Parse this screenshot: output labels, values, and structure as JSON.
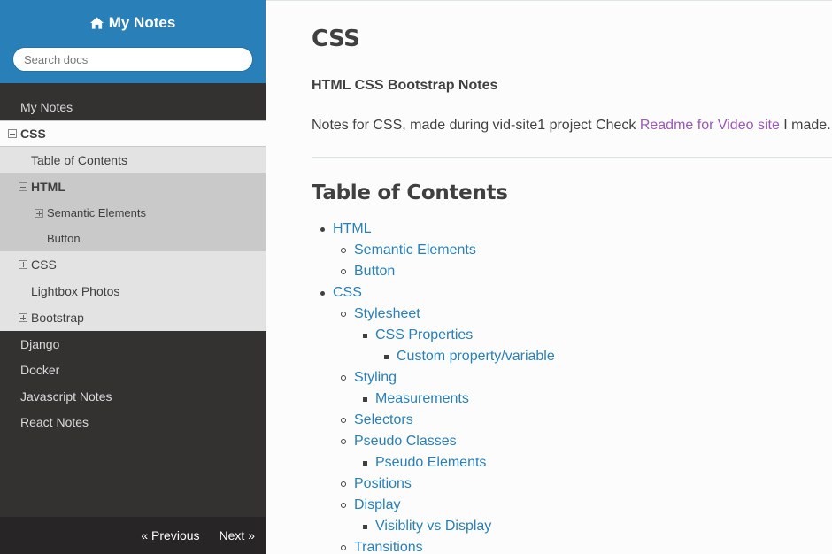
{
  "sidebar": {
    "brand": "My Notes",
    "search_placeholder": "Search docs",
    "nav": {
      "my_notes": "My Notes",
      "css": "CSS",
      "toc": "Table of Contents",
      "html": "HTML",
      "semantic": "Semantic Elements",
      "button": "Button",
      "css_sub": "CSS",
      "lightbox": "Lightbox Photos",
      "bootstrap": "Bootstrap",
      "django": "Django",
      "docker": "Docker",
      "javascript": "Javascript Notes",
      "react": "React Notes"
    },
    "footer": {
      "previous": "« Previous",
      "next": "Next »"
    }
  },
  "content": {
    "title": "CSS",
    "subtitle": "HTML CSS Bootstrap Notes",
    "intro_text": "Notes for CSS, made during vid-site1 project Check ",
    "intro_link": "Readme for Video site",
    "intro_end": " I made.",
    "toc_title": "Table of Contents",
    "toc": {
      "html": "HTML",
      "semantic": "Semantic Elements",
      "button": "Button",
      "css": "CSS",
      "stylesheet": "Stylesheet",
      "css_props": "CSS Properties",
      "custom_prop": "Custom property/variable",
      "styling": "Styling",
      "measurements": "Measurements",
      "selectors": "Selectors",
      "pseudo_classes": "Pseudo Classes",
      "pseudo_elements": "Pseudo Elements",
      "positions": "Positions",
      "display": "Display",
      "visibility": "Visiblity vs Display",
      "transitions": "Transitions"
    }
  }
}
